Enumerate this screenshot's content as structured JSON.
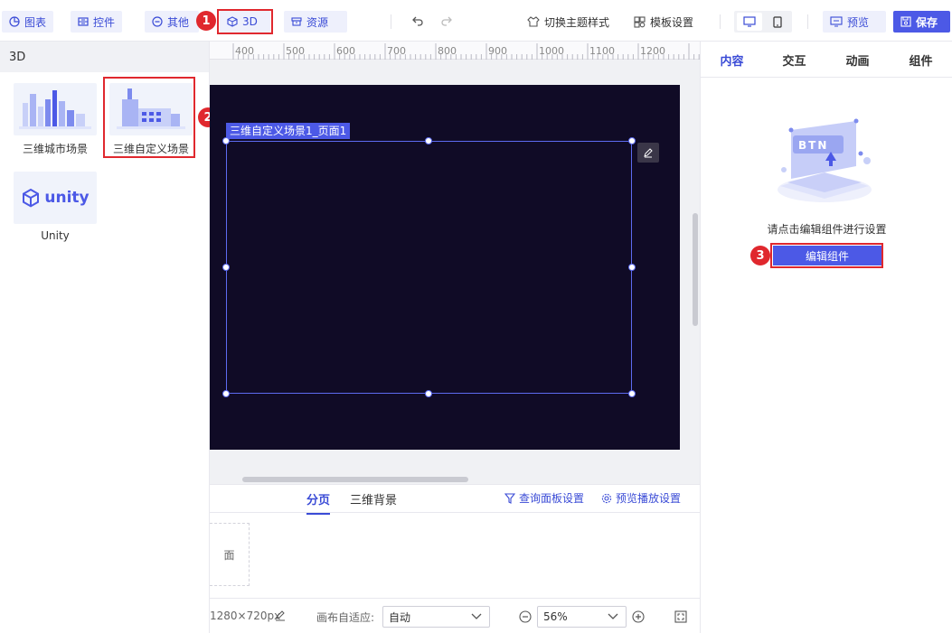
{
  "toolbar": {
    "chart": "图表",
    "control": "控件",
    "other": "其他",
    "threed": "3D",
    "resource": "资源",
    "switch_theme": "切换主题样式",
    "template_settings": "模板设置",
    "preview": "预览",
    "save": "保存"
  },
  "left_panel": {
    "title": "3D",
    "items": [
      {
        "label": "三维城市场景",
        "icon": "city-icon"
      },
      {
        "label": "三维自定义场景",
        "icon": "factory-icon"
      },
      {
        "label": "Unity",
        "icon": "unity-logo"
      }
    ],
    "unity_logo_text": "unity"
  },
  "ruler": {
    "ticks": [
      "400",
      "500",
      "600",
      "700",
      "800",
      "900",
      "1000",
      "1100",
      "1200"
    ]
  },
  "canvas": {
    "scene_label": "三维自定义场景1_页面1",
    "background_color": "#100b26"
  },
  "bottom": {
    "tabs": [
      "分页",
      "三维背景"
    ],
    "query_panel": "查询面板设置",
    "preview_play": "预览播放设置",
    "page_card": "面"
  },
  "status": {
    "size": "1280×720px",
    "fit_label": "画布自适应:",
    "fit_value": "自动",
    "zoom": "56%"
  },
  "right_panel": {
    "tabs": [
      "内容",
      "交互",
      "动画",
      "组件"
    ],
    "illustration_text": "BTN",
    "hint": "请点击编辑组件进行设置",
    "edit_button": "编辑组件"
  },
  "annotations": [
    "1",
    "2",
    "3"
  ],
  "colors": {
    "accent": "#4c59e6",
    "annotation": "#e0282e"
  }
}
